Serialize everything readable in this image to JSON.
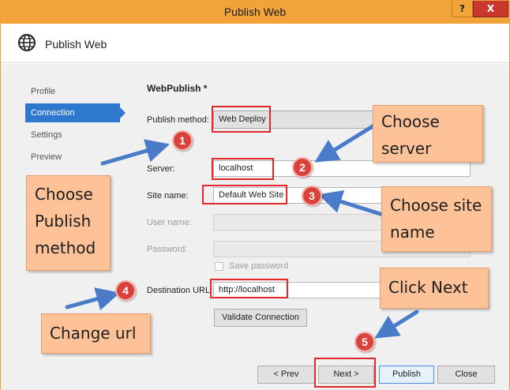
{
  "window": {
    "title": "Publish Web",
    "help_label": "?",
    "close_label": "X",
    "header_title": "Publish Web",
    "accent": "#f2a43a"
  },
  "nav": {
    "items": [
      {
        "label": "Profile",
        "active": false
      },
      {
        "label": "Connection",
        "active": true
      },
      {
        "label": "Settings",
        "active": false
      },
      {
        "label": "Preview",
        "active": false
      }
    ]
  },
  "form": {
    "section_title": "WebPublish *",
    "publish_method": {
      "label": "Publish method:",
      "value": "Web Deploy"
    },
    "server": {
      "label": "Server:",
      "value": "localhost"
    },
    "site_name": {
      "label": "Site name:",
      "value": "Default Web Site"
    },
    "user_name": {
      "label": "User name:",
      "value": ""
    },
    "password": {
      "label": "Password:",
      "value": ""
    },
    "save_password": {
      "label": "Save password",
      "checked": false
    },
    "destination_url": {
      "label": "Destination URL:",
      "value": "http://localhost"
    },
    "validate_label": "Validate Connection"
  },
  "footer": {
    "prev_label": "< Prev",
    "next_label": "Next >",
    "publish_label": "Publish",
    "close_label": "Close"
  },
  "annotations": {
    "notes": {
      "choose_server": [
        "Choose",
        "server"
      ],
      "choose_site": [
        "Choose site",
        "name"
      ],
      "choose_publish": [
        "Choose",
        "Publish",
        "method"
      ],
      "change_url": [
        "Change url"
      ],
      "click_next": [
        "Click Next"
      ]
    },
    "badges": [
      "1",
      "2",
      "3",
      "4",
      "5"
    ],
    "colors": {
      "note": "#fdc297",
      "badge": "#d8423a",
      "arrow": "#4a7bc8",
      "highlight": "#e2282a"
    }
  }
}
